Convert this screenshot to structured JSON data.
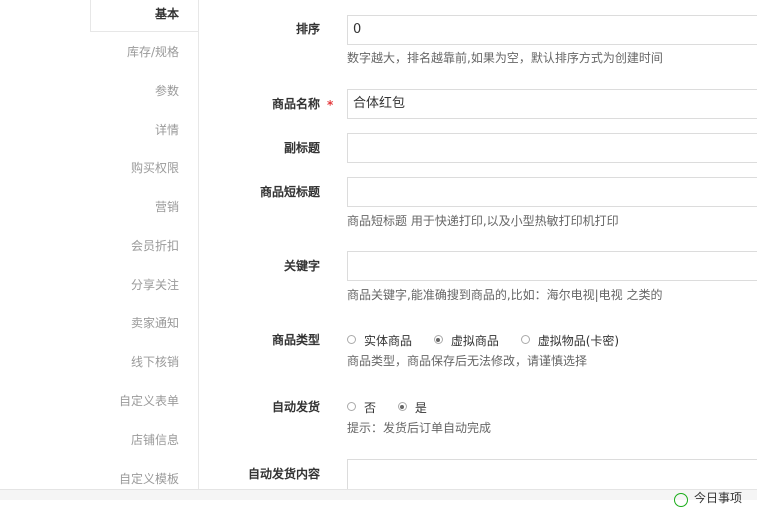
{
  "sidebar": {
    "items": [
      {
        "label": "基本",
        "active": true
      },
      {
        "label": "库存/规格"
      },
      {
        "label": "参数"
      },
      {
        "label": "详情"
      },
      {
        "label": "购买权限"
      },
      {
        "label": "营销"
      },
      {
        "label": "会员折扣"
      },
      {
        "label": "分享关注"
      },
      {
        "label": "卖家通知"
      },
      {
        "label": "线下核销"
      },
      {
        "label": "自定义表单"
      },
      {
        "label": "店铺信息"
      },
      {
        "label": "自定义模板"
      }
    ]
  },
  "form": {
    "sort": {
      "label": "排序",
      "value": "0",
      "help": "数字越大，排名越靠前,如果为空，默认排序方式为创建时间"
    },
    "name": {
      "label": "商品名称",
      "required_mark": "*",
      "value": "合体红包"
    },
    "subtitle": {
      "label": "副标题",
      "value": ""
    },
    "short_title": {
      "label": "商品短标题",
      "value": "",
      "help": "商品短标题 用于快递打印,以及小型热敏打印机打印"
    },
    "keywords": {
      "label": "关键字",
      "value": "",
      "help": "商品关键字,能准确搜到商品的,比如：海尔电视|电视 之类的"
    },
    "type": {
      "label": "商品类型",
      "options": [
        {
          "label": "实体商品",
          "checked": false
        },
        {
          "label": "虚拟商品",
          "checked": true
        },
        {
          "label": "虚拟物品(卡密)",
          "checked": false
        }
      ],
      "help": "商品类型，商品保存后无法修改，请谨慎选择"
    },
    "auto_ship": {
      "label": "自动发货",
      "options": [
        {
          "label": "否",
          "checked": false
        },
        {
          "label": "是",
          "checked": true
        }
      ],
      "help": "提示：发货后订单自动完成"
    },
    "auto_ship_content": {
      "label": "自动发货内容",
      "value": ""
    }
  },
  "bottom_bar": {
    "text": "今日事项"
  }
}
